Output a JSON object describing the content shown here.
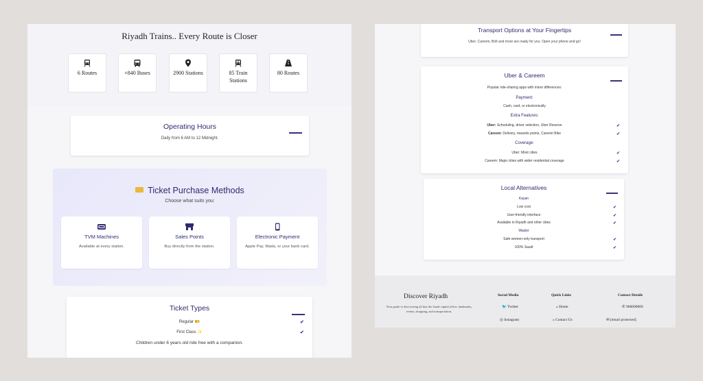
{
  "left": {
    "hero_title": "Riyadh Trains.. Every Route is Closer",
    "stats": [
      {
        "label": "6 Routes",
        "icon": "train-icon"
      },
      {
        "label": "+840 Buses",
        "icon": "bus-icon"
      },
      {
        "label": "2900 Stations",
        "icon": "map-pin-icon"
      },
      {
        "label": "85 Train Stations",
        "icon": "train-icon"
      },
      {
        "label": "80 Routes",
        "icon": "road-icon"
      }
    ],
    "operating_hours": {
      "title": "Operating Hours",
      "text": "Daily from 6 AM to 12 Midnight."
    },
    "ticket_methods": {
      "title": "Ticket Purchase Methods",
      "subtitle": "Choose what suits you:",
      "items": [
        {
          "title": "TVM Machines",
          "desc": "Available at every station.",
          "icon": "ticket-machine-icon"
        },
        {
          "title": "Sales Points",
          "desc": "Buy directly from the station.",
          "icon": "store-icon"
        },
        {
          "title": "Electronic Payment",
          "desc": "Apple Pay, Mada, or your bank card.",
          "icon": "mobile-icon"
        }
      ]
    },
    "ticket_types": {
      "title": "Ticket Types",
      "items": [
        "Regular 🎫",
        "First Class ✨"
      ],
      "note": "Children under 6 years old ride free with a companion."
    }
  },
  "right": {
    "transport": {
      "title": "Transport Options at Your Fingertips",
      "text": "Uber, Careem, Bolt and more are ready for you. Open your phone and go!"
    },
    "uber": {
      "title": "Uber & Careem",
      "intro": "Popular ride-sharing apps with minor differences:",
      "payment_title": "Payment:",
      "payment_text": "Cash, card, or electronically",
      "extra_title": "Extra Features:",
      "extra_uber_label": "Uber:",
      "extra_uber_text": "Scheduling, driver selection, Uber Reserve",
      "extra_careem_label": "Careem:",
      "extra_careem_text": "Delivery, rewards points, Careem Bike",
      "coverage_title": "Coverage:",
      "coverage_uber": "Uber: Most cities",
      "coverage_careem": "Careem: Major cities with wider residential coverage"
    },
    "local": {
      "title": "Local Alternatives",
      "kayan_title": "Kayan",
      "kayan_items": [
        "Low cost",
        "User-friendly interface",
        "Available in Riyadh and other cities"
      ],
      "wasler_title": "Wasler",
      "wasler_items": [
        "Safe women-only transport",
        "100% Saudi"
      ]
    },
    "footer": {
      "brand": "Discover Riyadh",
      "tagline": "Your guide to discovering all that the Saudi capital offers: landmarks, events, shopping, and transportation.",
      "social_title": "Social Media",
      "social_items": [
        "Twitter",
        "Instagram"
      ],
      "links_title": "Quick Links",
      "links_items": [
        "Home",
        "Contact Us"
      ],
      "contact_title": "Contact Details",
      "phone": "966000000",
      "email": "[email protected]"
    }
  },
  "colors": {
    "accent": "#2e2a6e",
    "check": "#3b3f9c",
    "ticket_panel": "#e8e8fb"
  }
}
